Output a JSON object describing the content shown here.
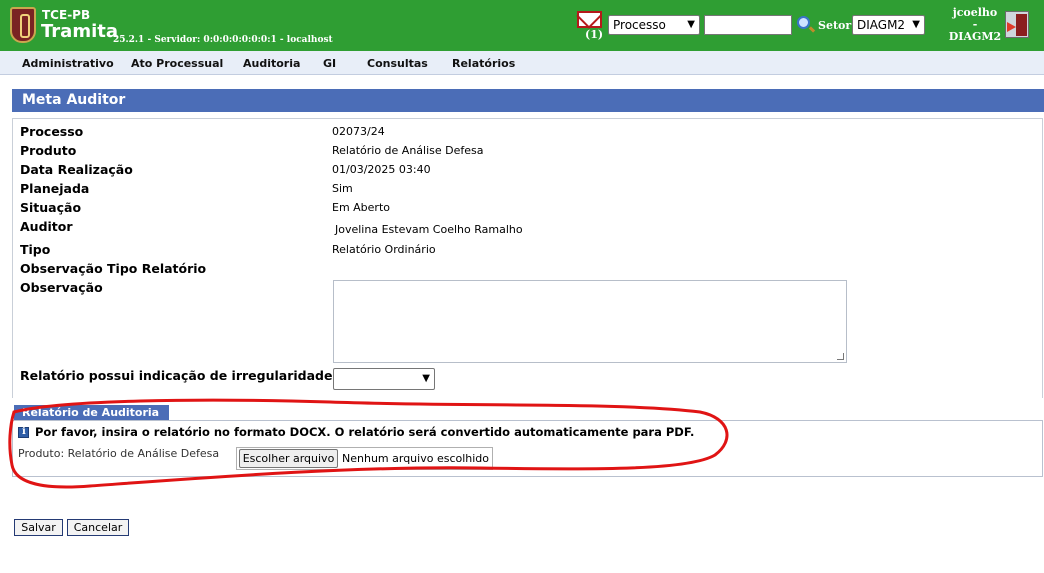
{
  "header": {
    "org": "TCE-PB",
    "app": "Tramita",
    "server": "25.2.1 - Servidor: 0:0:0:0:0:0:0:1 - localhost",
    "mail_count": "(1)",
    "processo_select": "Processo",
    "search_value": "",
    "setor_label": "Setor",
    "setor_select": "DIAGM2",
    "user_name": "jcoelho",
    "user_sep": "-",
    "user_setor": "DIAGM2"
  },
  "menu": {
    "items": [
      "Administrativo",
      "Ato Processual",
      "Auditoria",
      "GI",
      "Consultas",
      "Relatórios"
    ]
  },
  "page": {
    "title": "Meta Auditor"
  },
  "form": {
    "fields": [
      {
        "label": "Processo",
        "value": "02073/24"
      },
      {
        "label": "Produto",
        "value": "Relatório de Análise Defesa"
      },
      {
        "label": "Data Realização",
        "value": "01/03/2025 03:40"
      },
      {
        "label": "Planejada",
        "value": "Sim"
      },
      {
        "label": "Situação",
        "value": "Em Aberto"
      },
      {
        "label": "Auditor",
        "value": "Jovelina Estevam Coelho Ramalho"
      },
      {
        "label": "Tipo",
        "value": "Relatório Ordinário"
      },
      {
        "label": "Observação Tipo Relatório",
        "value": ""
      },
      {
        "label": "Observação",
        "value": ""
      }
    ],
    "irreg_label": "Relatório possui indicação de irregularidade?",
    "irreg_value": ""
  },
  "relatorio": {
    "tab_label": "Relatório de Auditoria",
    "info": "Por favor, insira o relatório no formato DOCX. O relatório será convertido automaticamente para PDF.",
    "produto": "Produto: Relatório de Análise Defesa",
    "file_button": "Escolher arquivo",
    "file_none": "Nenhum arquivo escolhido"
  },
  "actions": {
    "save": "Salvar",
    "cancel": "Cancelar"
  },
  "colors": {
    "header_green": "#2f9e33",
    "title_blue": "#4b6db7",
    "annotation_red": "#e01414"
  }
}
